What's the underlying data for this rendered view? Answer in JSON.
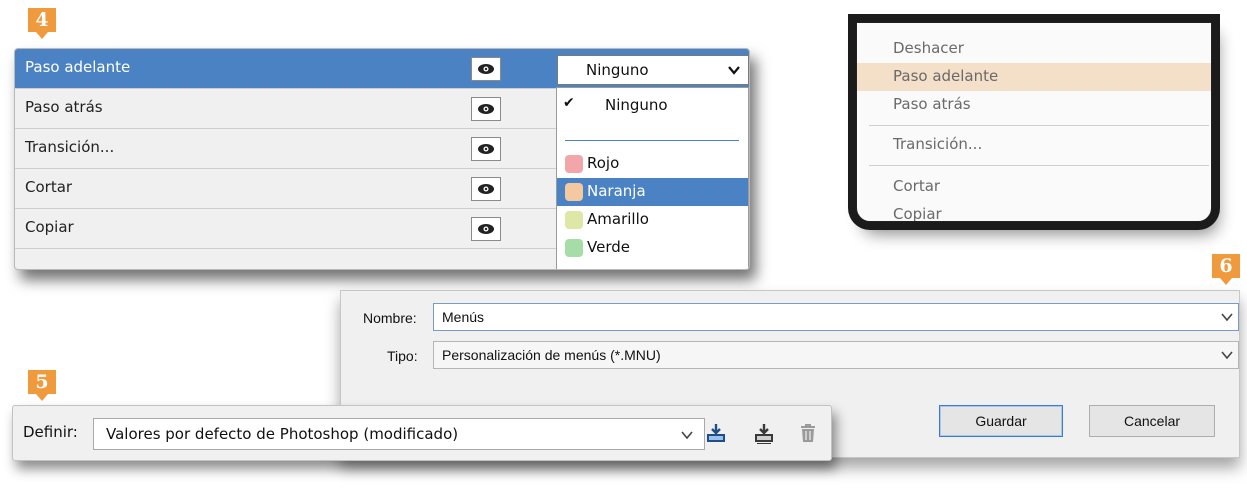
{
  "steps": {
    "s4": "4",
    "s5": "5",
    "s6": "6"
  },
  "colors": {
    "accent": "#4a82c4",
    "step_badge": "#f09a3e",
    "menu_highlight": "#f4dfc8"
  },
  "panel4": {
    "rows": [
      {
        "label": "Paso adelante",
        "selected": true
      },
      {
        "label": "Paso atrás"
      },
      {
        "label": "Transición..."
      },
      {
        "label": "Cortar"
      },
      {
        "label": "Copiar"
      }
    ],
    "eye_icon": "eye-icon",
    "combo": {
      "value": "Ninguno",
      "arrow_icon": "chevron-down-icon"
    },
    "dropdown": {
      "none_option": "Ninguno",
      "colors": [
        {
          "label": "Rojo",
          "swatch": "#f3a6aa"
        },
        {
          "label": "Naranja",
          "swatch": "#f4c9a0",
          "highlighted": true
        },
        {
          "label": "Amarillo",
          "swatch": "#dfe7a6"
        },
        {
          "label": "Verde",
          "swatch": "#a6dca8"
        }
      ]
    }
  },
  "context_menu": {
    "items": [
      "Deshacer",
      "Paso adelante",
      "Paso atrás",
      "Transición...",
      "Cortar",
      "Copiar"
    ],
    "highlighted": "Paso adelante"
  },
  "save_dialog": {
    "name_label": "Nombre:",
    "name_value": "Menús",
    "type_label": "Tipo:",
    "type_value": "Personalización de menús (*.MNU)",
    "save_button": "Guardar",
    "cancel_button": "Cancelar"
  },
  "set_bar": {
    "label": "Definir:",
    "value": "Valores por defecto de Photoshop (modificado)",
    "icons": [
      "save-set-icon",
      "save-set-alt-icon",
      "trash-icon"
    ]
  }
}
